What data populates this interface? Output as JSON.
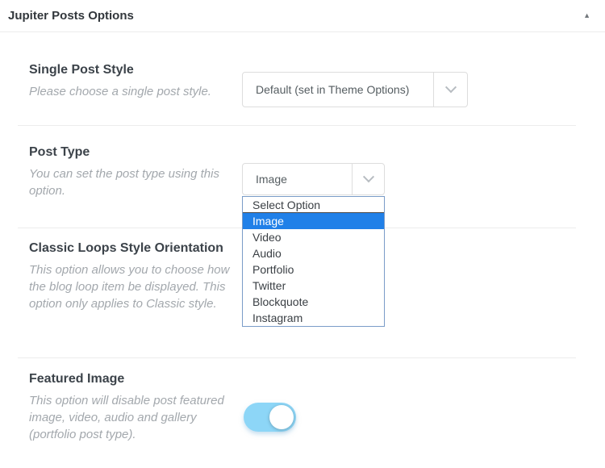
{
  "panel": {
    "title": "Jupiter Posts Options",
    "collapse_icon": "▲"
  },
  "sections": [
    {
      "id": "single-post-style",
      "heading": "Single Post Style",
      "description": "Please choose a single post style.",
      "control": {
        "type": "select",
        "value": "Default (set in Theme Options)"
      }
    },
    {
      "id": "post-type",
      "heading": "Post Type",
      "description": "You can set the post type using this option.",
      "control": {
        "type": "select",
        "value": "Image"
      },
      "dropdown": {
        "open": true,
        "options": [
          "Select Option",
          "Image",
          "Video",
          "Audio",
          "Portfolio",
          "Twitter",
          "Blockquote",
          "Instagram"
        ],
        "selected": "Image"
      }
    },
    {
      "id": "classic-loops-style-orientation",
      "heading": "Classic Loops Style Orientation",
      "description": "This option allows you to choose how the blog loop item be displayed. This option only applies to Classic style."
    },
    {
      "id": "featured-image",
      "heading": "Featured Image",
      "description": "This option will disable post featured image, video, audio and gallery (portfolio post type).",
      "control": {
        "type": "toggle",
        "state": "on"
      }
    }
  ],
  "colors": {
    "dropdown_highlight": "#2080e8",
    "dropdown_border": "#7a9cc8",
    "toggle_on": "#8dd6f7",
    "separator": "#ececec"
  }
}
